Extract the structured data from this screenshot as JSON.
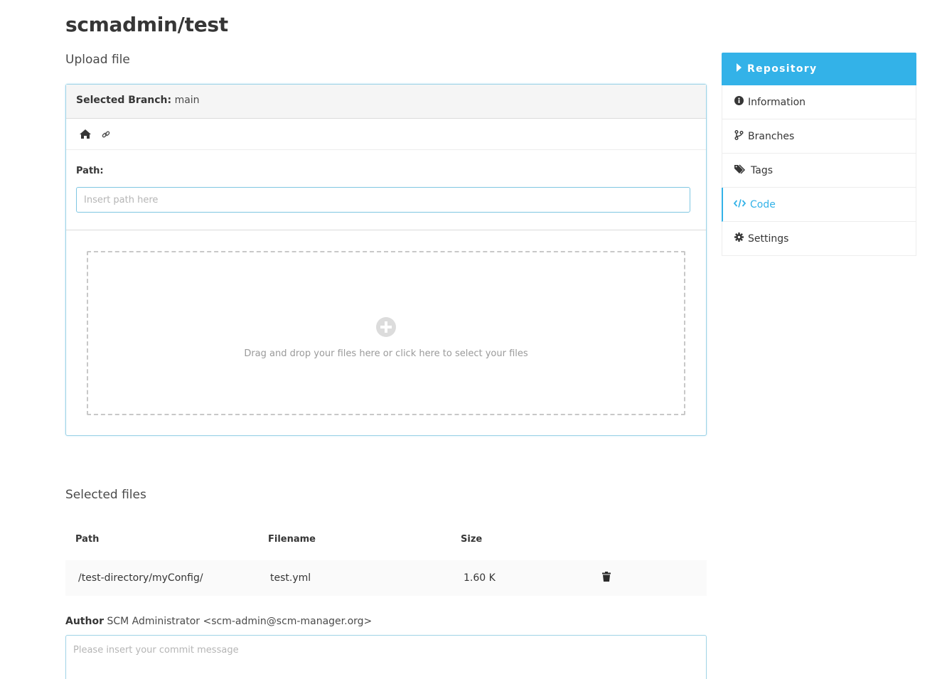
{
  "header": {
    "title": "scmadmin/test",
    "subtitle": "Upload file"
  },
  "upload": {
    "branch_label": "Selected Branch:",
    "branch_value": "main",
    "path_label": "Path:",
    "path_placeholder": "Insert path here",
    "dropzone_text": "Drag and drop your files here or click here to select your files"
  },
  "files": {
    "title": "Selected files",
    "columns": [
      "Path",
      "Filename",
      "Size"
    ],
    "rows": [
      {
        "path": "/test-directory/myConfig/",
        "filename": "test.yml",
        "size": "1.60 K"
      }
    ]
  },
  "commit": {
    "author_label": "Author",
    "author_value": "SCM Administrator <scm-admin@scm-manager.org>",
    "message_placeholder": "Please insert your commit message"
  },
  "sidebar": {
    "heading": "Repository",
    "items": [
      {
        "label": "Information",
        "icon": "info-circle-icon"
      },
      {
        "label": "Branches",
        "icon": "code-branch-icon"
      },
      {
        "label": "Tags",
        "icon": "tags-icon"
      },
      {
        "label": "Code",
        "icon": "code-icon",
        "active": true
      },
      {
        "label": "Settings",
        "icon": "cog-icon"
      }
    ]
  },
  "colors": {
    "accent": "#33b2e8",
    "text": "#363636",
    "muted": "#9a9a9a"
  }
}
